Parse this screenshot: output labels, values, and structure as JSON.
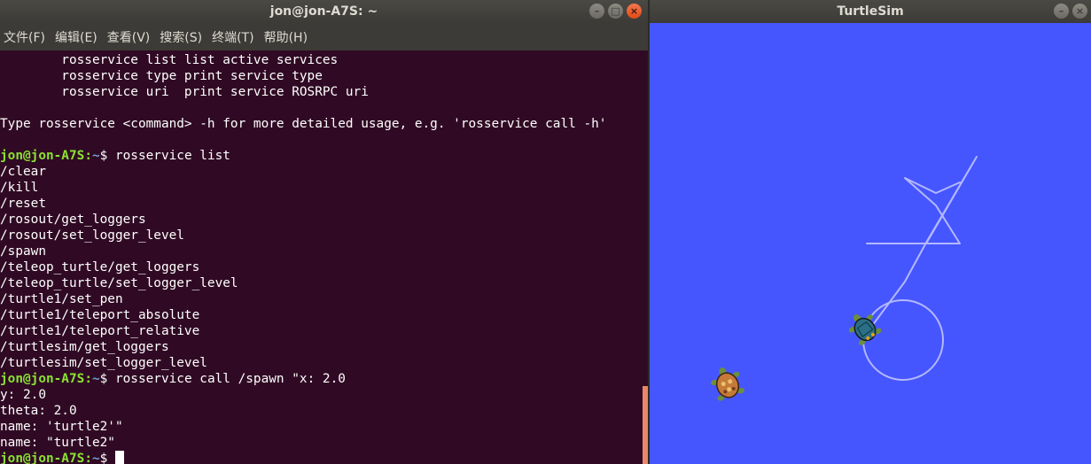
{
  "terminal": {
    "title": "jon@jon-A7S: ~",
    "window_buttons": {
      "minimize": "–",
      "maximize": "□",
      "close": "×"
    },
    "menu": [
      "文件(F)",
      "编辑(E)",
      "查看(V)",
      "搜索(S)",
      "终端(T)",
      "帮助(H)"
    ],
    "lines": [
      {
        "text": "        rosservice list list active services"
      },
      {
        "text": "        rosservice type print service type"
      },
      {
        "text": "        rosservice uri  print service ROSRPC uri"
      },
      {
        "text": ""
      },
      {
        "text": "Type rosservice <command> -h for more detailed usage, e.g. 'rosservice call -h'"
      },
      {
        "text": ""
      },
      {
        "prompt_user": "jon@jon-A7S",
        "prompt_sep": ":",
        "prompt_path": "~",
        "prompt_end": "$ ",
        "text": "rosservice list"
      },
      {
        "text": "/clear"
      },
      {
        "text": "/kill"
      },
      {
        "text": "/reset"
      },
      {
        "text": "/rosout/get_loggers"
      },
      {
        "text": "/rosout/set_logger_level"
      },
      {
        "text": "/spawn"
      },
      {
        "text": "/teleop_turtle/get_loggers"
      },
      {
        "text": "/teleop_turtle/set_logger_level"
      },
      {
        "text": "/turtle1/set_pen"
      },
      {
        "text": "/turtle1/teleport_absolute"
      },
      {
        "text": "/turtle1/teleport_relative"
      },
      {
        "text": "/turtlesim/get_loggers"
      },
      {
        "text": "/turtlesim/set_logger_level"
      },
      {
        "prompt_user": "jon@jon-A7S",
        "prompt_sep": ":",
        "prompt_path": "~",
        "prompt_end": "$ ",
        "text": "rosservice call /spawn \"x: 2.0"
      },
      {
        "text": "y: 2.0"
      },
      {
        "text": "theta: 2.0"
      },
      {
        "text": "name: 'turtle2'\""
      },
      {
        "text": "name: \"turtle2\""
      },
      {
        "prompt_user": "jon@jon-A7S",
        "prompt_sep": ":",
        "prompt_path": "~",
        "prompt_end": "$ ",
        "text": "",
        "cursor": true
      }
    ]
  },
  "turtlesim": {
    "title": "TurtleSim",
    "window_buttons": {
      "minimize": "–",
      "close": "×"
    },
    "background_color": "#4556ff",
    "pen_color": "#b3b8ff",
    "turtles": [
      {
        "name": "turtle1",
        "icon": "turtle-icon",
        "shell_color": "#2a6f86"
      },
      {
        "name": "turtle2",
        "icon": "turtle-icon",
        "shell_color": "#c57a3a"
      }
    ]
  }
}
